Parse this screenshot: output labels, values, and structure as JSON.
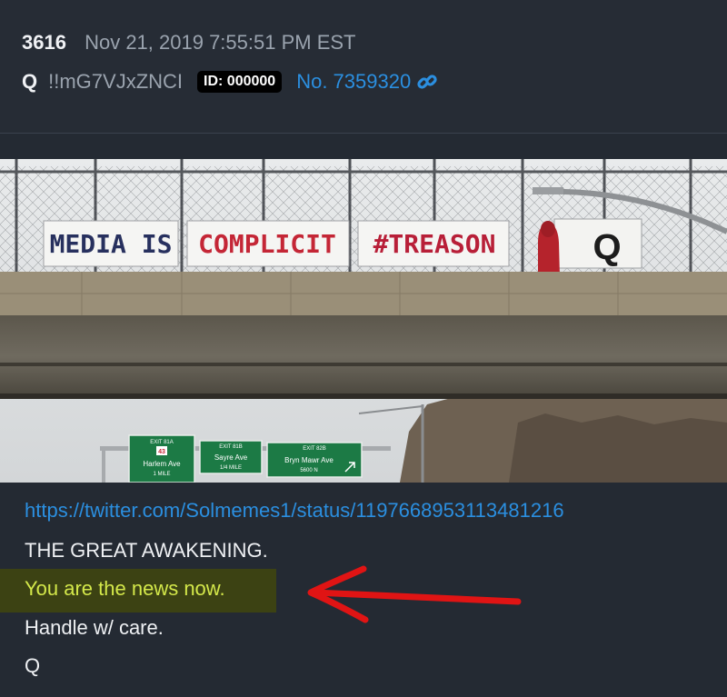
{
  "post": {
    "number": "3616",
    "timestamp": "Nov 21, 2019 7:55:51 PM EST",
    "author": "Q",
    "tripcode": "!!mG7VJxZNCI",
    "id_badge": "ID: 000000",
    "post_no": "No. 7359320",
    "link_icon": "link-icon"
  },
  "photo": {
    "banner_words": [
      "MEDIA IS",
      "COMPLICIT",
      "#TREASON",
      "Q"
    ],
    "signs": [
      {
        "exit": "EXIT 81A",
        "route": "43",
        "street": "Harlem Ave",
        "distance": "1 MILE"
      },
      {
        "exit": "EXIT 81B",
        "street": "Sayre Ave",
        "distance": "1/4 MILE"
      },
      {
        "exit": "EXIT 82B",
        "street": "Bryn Mawr Ave",
        "distance": "5600 N"
      }
    ]
  },
  "body": {
    "url": "https://twitter.com/Solmemes1/status/1197668953113481216",
    "lines": [
      "THE GREAT AWAKENING.",
      "You are the news now.",
      "Handle w/ care.",
      "Q"
    ]
  },
  "colors": {
    "background": "#242a33",
    "link": "#2b8fe0",
    "highlight_bg": "#3c4213",
    "highlight_text": "#d4e84a",
    "arrow": "#e01414"
  }
}
